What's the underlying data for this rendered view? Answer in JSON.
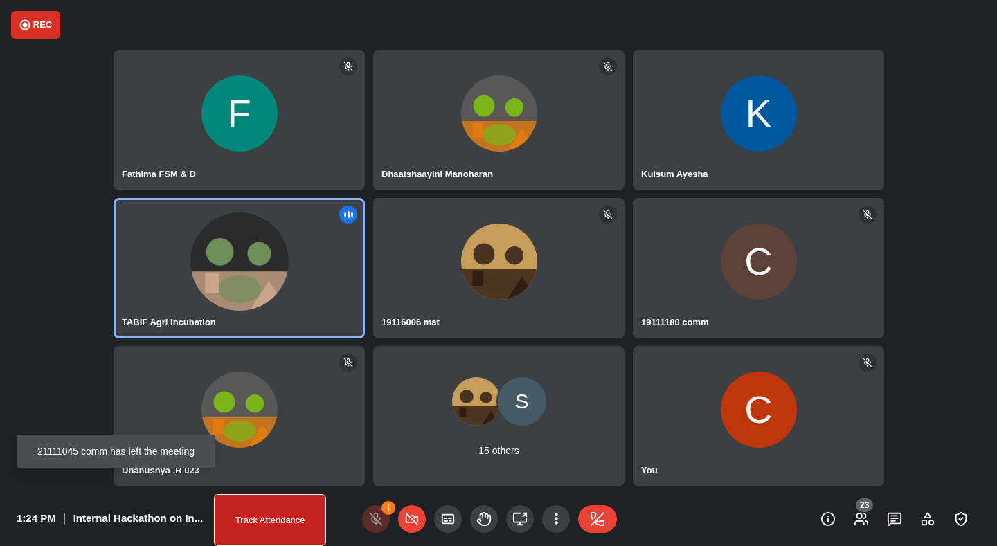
{
  "recording": {
    "label": "REC"
  },
  "tiles": [
    {
      "name": "Fathima FSM & D",
      "kind": "letter",
      "letter": "F",
      "color": "#00897b",
      "muted": true,
      "speaking": false
    },
    {
      "name": "Dhaatshaayini Manoharan",
      "kind": "picture",
      "muted": true,
      "speaking": false
    },
    {
      "name": "Kulsum Ayesha",
      "kind": "letter",
      "letter": "K",
      "color": "#01579b",
      "muted": false,
      "speaking": false
    },
    {
      "name": "TABIF Agri Incubation",
      "kind": "picture",
      "muted": false,
      "speaking": true
    },
    {
      "name": "19116006 mat",
      "kind": "picture",
      "muted": true,
      "speaking": false
    },
    {
      "name": "19111180 comm",
      "kind": "letter",
      "letter": "C",
      "color": "#5d4037",
      "muted": true,
      "speaking": false
    },
    {
      "name": "Dhanushya .R 023",
      "kind": "picture",
      "muted": true,
      "speaking": false
    },
    {
      "kind": "group",
      "label": "15 others",
      "avatars": [
        {
          "kind": "picture"
        },
        {
          "kind": "letter",
          "letter": "S",
          "color": "#455a64"
        }
      ]
    },
    {
      "name": "You",
      "kind": "letter",
      "letter": "C",
      "color": "#bf360c",
      "muted": true,
      "speaking": false
    }
  ],
  "toast": "21111045 comm has left the meeting",
  "bottom_bar": {
    "time": "1:24 PM",
    "meeting_title": "Internal Hackathon on In...",
    "track_attendance": "Track Attendance",
    "controls": [
      {
        "kind": "mic",
        "on": false,
        "warning": "!"
      },
      {
        "kind": "camera",
        "on": false
      },
      {
        "kind": "captions"
      },
      {
        "kind": "hand"
      },
      {
        "kind": "present"
      },
      {
        "kind": "more"
      },
      {
        "kind": "end"
      }
    ],
    "side_buttons": [
      {
        "kind": "info"
      },
      {
        "kind": "people",
        "badge": "23"
      },
      {
        "kind": "chat"
      },
      {
        "kind": "activities"
      },
      {
        "kind": "host"
      }
    ]
  }
}
